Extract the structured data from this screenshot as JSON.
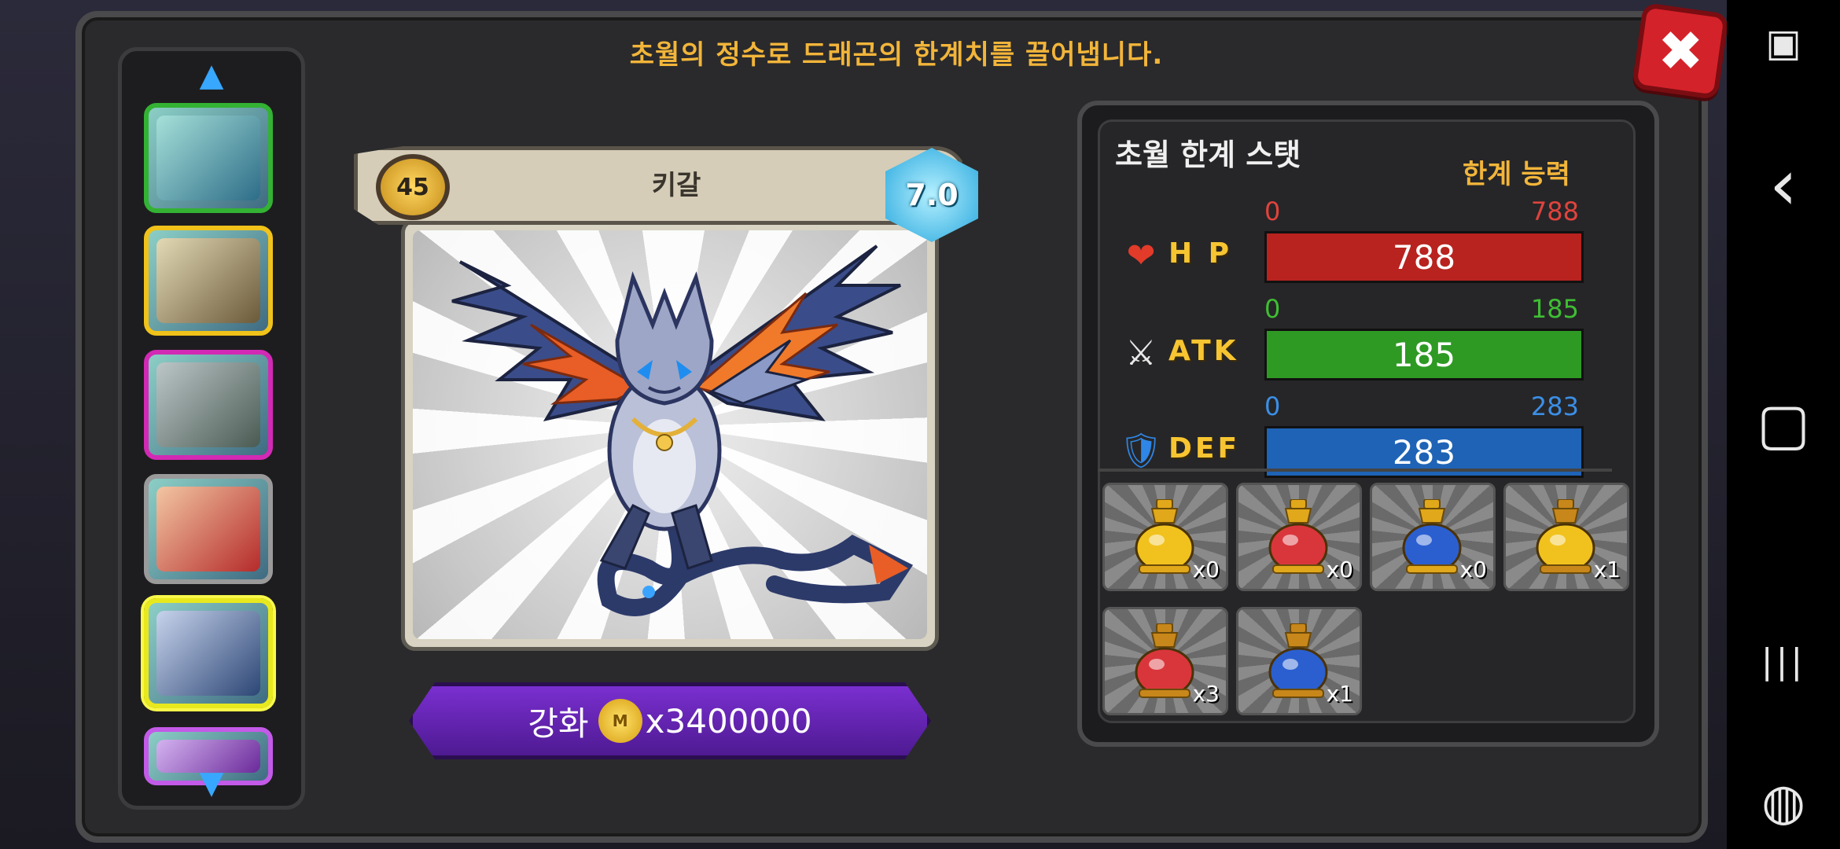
{
  "heading": "초월의 정수로 드래곤의 한계치를 끌어냅니다.",
  "close_label": "✖",
  "side_list": {
    "up_arrow": "▲",
    "down_arrow": "▼",
    "thumbs": [
      {
        "border": "#33b233",
        "colorA": "#a6e0d9",
        "colorB": "#2d6d88"
      },
      {
        "border": "#f0c21a",
        "colorA": "#e2d9b5",
        "colorB": "#6b5a3a"
      },
      {
        "border": "#d22ab4",
        "colorA": "#bcc6c8",
        "colorB": "#4a5b53"
      },
      {
        "border": "#9a9a9a",
        "colorA": "#f2c6a2",
        "colorB": "#b52b2b"
      },
      {
        "border": "#e8e81e",
        "colorA": "#c7d3ec",
        "colorB": "#2c4675"
      },
      {
        "border": "#c35ae8",
        "colorA": "#d4b3f0",
        "colorB": "#6b2a9a"
      }
    ]
  },
  "card": {
    "level": "45",
    "name": "키갈",
    "grade": "7.0"
  },
  "upgrade": {
    "label": "강화",
    "coin_label": "M",
    "cost": "x3400000"
  },
  "stats": {
    "title": "초월 한계 스탯",
    "subtitle": "한계 능력",
    "rows": [
      {
        "label": "H P",
        "min": "0",
        "max": "788",
        "value": "788",
        "fill": 1.0,
        "bar_color": "#b8231f",
        "range_color": "#e0433d",
        "icon": "❤"
      },
      {
        "label": "ATK",
        "min": "0",
        "max": "185",
        "value": "185",
        "fill": 1.0,
        "bar_color": "#2e9a24",
        "range_color": "#3fbe33",
        "icon": "⚔"
      },
      {
        "label": "DEF",
        "min": "0",
        "max": "283",
        "value": "283",
        "fill": 1.0,
        "bar_color": "#1f63b6",
        "range_color": "#3b8fe6",
        "icon": "🛡"
      }
    ]
  },
  "items": [
    {
      "count": "x0",
      "color": "#f1c21e",
      "cap": "#e0a81a"
    },
    {
      "count": "x0",
      "color": "#d9363c",
      "cap": "#e0a81a"
    },
    {
      "count": "x0",
      "color": "#2b5fd0",
      "cap": "#e0a81a"
    },
    {
      "count": "x1",
      "color": "#f1c21e",
      "cap": "#c8871a"
    },
    {
      "count": "x3",
      "color": "#d9363c",
      "cap": "#c8871a"
    },
    {
      "count": "x1",
      "color": "#2b5fd0",
      "cap": "#c8871a"
    }
  ],
  "navbar": {
    "screen_icon": "▣",
    "back_icon": "‹",
    "home_icon": "▢",
    "recents_icon": "|||",
    "game_icon": "◍"
  }
}
